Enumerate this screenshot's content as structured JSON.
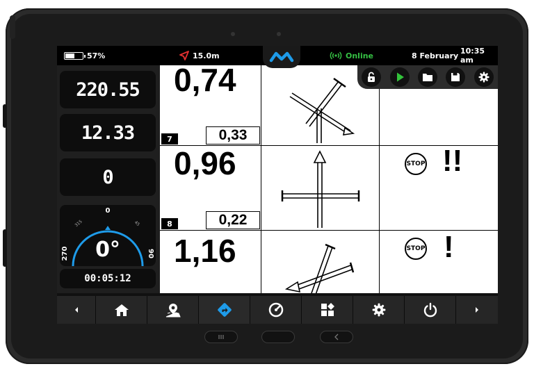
{
  "status": {
    "battery_percent": "57%",
    "battery_level": 0.57,
    "distance": "15.0m",
    "connection": "Online",
    "date": "8 February",
    "time": "10:35 am"
  },
  "toolbar": [
    "unlock-icon",
    "play-icon",
    "folder-icon",
    "save-icon",
    "gear-icon"
  ],
  "left": {
    "value1": "220.55",
    "value2": "12.33",
    "value3": "0",
    "compass": {
      "north": "0",
      "west": "270",
      "east": "90",
      "nw": "315",
      "ne": "45",
      "heading": "0°"
    },
    "timer": "00:05:12"
  },
  "rows": [
    {
      "value": "0,74",
      "sub": "0,33",
      "index": "7",
      "alert": ""
    },
    {
      "value": "0,96",
      "sub": "0,22",
      "index": "8",
      "stop": "STOP",
      "alert": "!!"
    },
    {
      "value": "1,16",
      "sub": "",
      "index": "",
      "stop": "STOP",
      "alert": "!"
    }
  ],
  "nav": [
    "chevron-left-icon",
    "home-icon",
    "map-pin-icon",
    "navigation-icon",
    "gauge-icon",
    "widgets-icon",
    "gear-icon",
    "power-icon",
    "chevron-right-icon"
  ],
  "colors": {
    "accent": "#1e9be9",
    "online": "#35c043",
    "alert_arrow": "#e53030",
    "play": "#33c33b"
  }
}
